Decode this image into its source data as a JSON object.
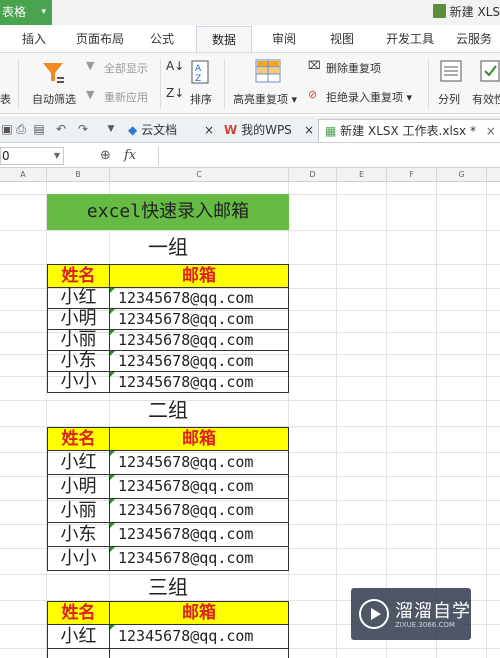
{
  "titlebar": {
    "app_tag": "表格",
    "doc_title": "新建 XLS"
  },
  "menu": {
    "tabs": [
      "插入",
      "页面布局",
      "公式",
      "数据",
      "审阅",
      "视图",
      "开发工具",
      "云服务"
    ],
    "active": "数据"
  },
  "ribbon": {
    "left_cut": "表",
    "auto_filter": "自动筛选",
    "show_all": "全部显示",
    "reapply": "重新应用",
    "sort": "排序",
    "highlight_dup": "高亮重复项",
    "delete_dup": "删除重复项",
    "reject_dup": "拒绝录入重复项",
    "split": "分列",
    "valid": "有效性"
  },
  "doctabs": {
    "cloud": "云文档",
    "mywps": "我的WPS",
    "active_file": "新建 XLSX 工作表.xlsx *"
  },
  "formula": {
    "namebox": "0",
    "fx": "fx"
  },
  "columns": [
    "A",
    "B",
    "C",
    "D",
    "E",
    "F",
    "G"
  ],
  "sheet": {
    "title": "excel快速录入邮箱",
    "header_name": "姓名",
    "header_mail": "邮箱",
    "groups": [
      {
        "label": "一组",
        "rows": [
          {
            "name": "小红",
            "mail": "12345678@qq.com"
          },
          {
            "name": "小明",
            "mail": "12345678@qq.com"
          },
          {
            "name": "小丽",
            "mail": "12345678@qq.com"
          },
          {
            "name": "小东",
            "mail": "12345678@qq.com"
          },
          {
            "name": "小小",
            "mail": "12345678@qq.com"
          }
        ]
      },
      {
        "label": "二组",
        "rows": [
          {
            "name": "小红",
            "mail": "12345678@qq.com"
          },
          {
            "name": "小明",
            "mail": "12345678@qq.com"
          },
          {
            "name": "小丽",
            "mail": "12345678@qq.com"
          },
          {
            "name": "小东",
            "mail": "12345678@qq.com"
          },
          {
            "name": "小小",
            "mail": "12345678@qq.com"
          }
        ]
      },
      {
        "label": "三组",
        "rows": [
          {
            "name": "小红",
            "mail": "12345678@qq.com"
          }
        ]
      }
    ]
  },
  "watermark": {
    "title": "溜溜自学",
    "url": "ZIXUE.3066.COM"
  },
  "colors": {
    "title_bg": "#66bb44",
    "header_bg": "#ffff00",
    "header_text": "#e02020",
    "app_green": "#4aa34f"
  }
}
